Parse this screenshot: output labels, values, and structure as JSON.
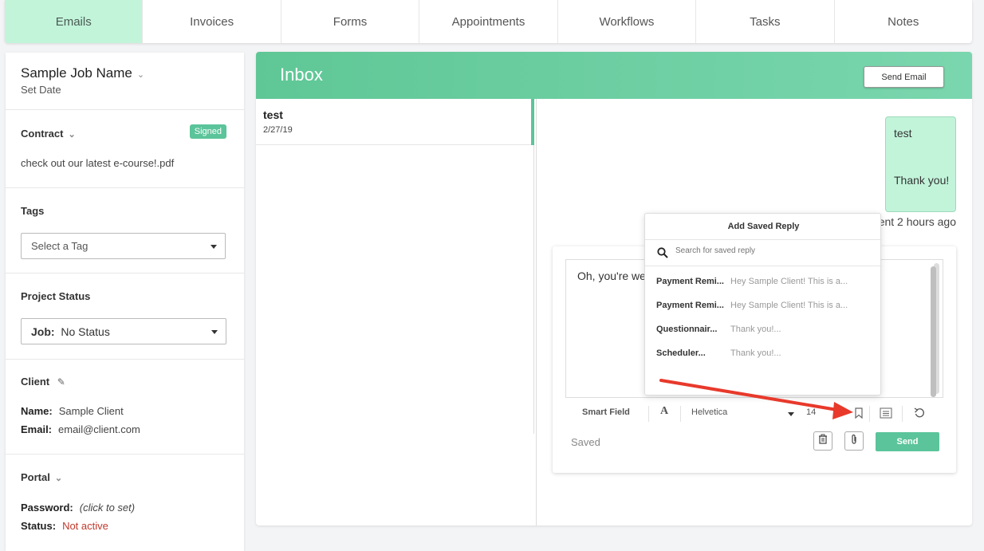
{
  "tabs": [
    "Emails",
    "Invoices",
    "Forms",
    "Appointments",
    "Workflows",
    "Tasks",
    "Notes"
  ],
  "sidebar": {
    "job_name": "Sample Job Name",
    "set_date": "Set Date",
    "contract_title": "Contract",
    "contract_badge": "Signed",
    "contract_file": "check out our latest e-course!.pdf",
    "tags_title": "Tags",
    "tags_placeholder": "Select a Tag",
    "status_title": "Project Status",
    "status_label": "Job:",
    "status_value": "No Status",
    "client_title": "Client",
    "client_name_label": "Name:",
    "client_name": "Sample Client",
    "client_email_label": "Email:",
    "client_email": "email@client.com",
    "portal_title": "Portal",
    "password_label": "Password:",
    "password_value": "(click to set)",
    "portal_status_label": "Status:",
    "portal_status_value": "Not active"
  },
  "main": {
    "title": "Inbox",
    "send_email": "Send Email",
    "thread": {
      "subject": "test",
      "date": "2/27/19"
    },
    "message": {
      "line1": "test",
      "line2": "Thank you!",
      "sent": "ent 2 hours ago"
    },
    "composer": {
      "text": "Oh, you're we",
      "smart_field": "Smart Field",
      "font": "Helvetica",
      "size": "14",
      "saved": "Saved",
      "send": "Send"
    }
  },
  "popover": {
    "title": "Add Saved Reply",
    "search_placeholder": "Search for saved reply",
    "items": [
      {
        "name": "Payment Remi...",
        "preview": "Hey Sample Client! This is a..."
      },
      {
        "name": "Payment Remi...",
        "preview": "Hey Sample Client! This is a..."
      },
      {
        "name": "Questionnair...",
        "preview": "Thank you!..."
      },
      {
        "name": "Scheduler...",
        "preview": "Thank you!..."
      }
    ]
  },
  "colors": {
    "accent": "#5bc49a",
    "active_tab": "#c2f4da",
    "arrow": "#e8392b",
    "danger": "#c0392b"
  }
}
